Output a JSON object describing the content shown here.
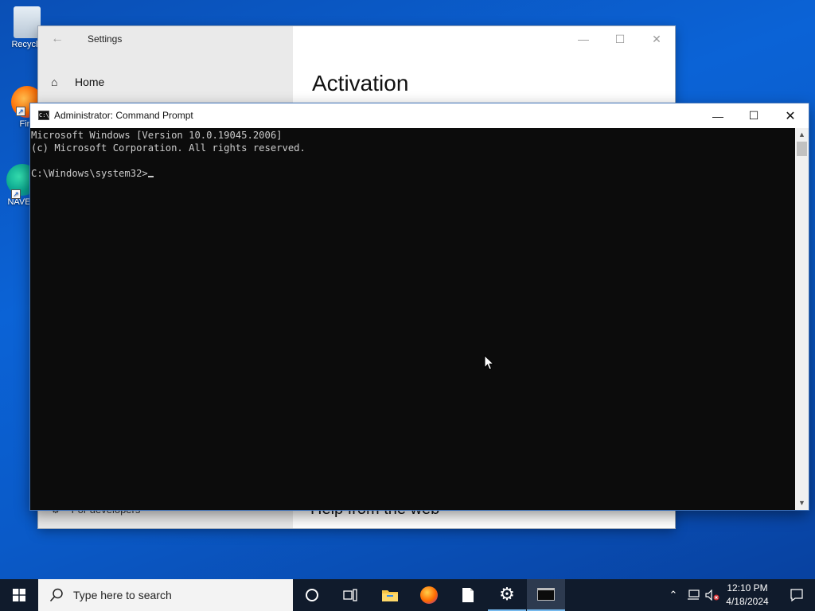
{
  "desktop": {
    "icons": [
      {
        "label": "Recycle"
      },
      {
        "label": "Fire"
      },
      {
        "label": "NAVER"
      }
    ]
  },
  "settings_window": {
    "title": "Settings",
    "nav_home": "Home",
    "page_heading": "Activation",
    "nav_partial": "For developers",
    "section_partial": "Help from the web"
  },
  "cmd_window": {
    "title": "Administrator: Command Prompt",
    "icon_text": "C:\\",
    "lines": [
      "Microsoft Windows [Version 10.0.19045.2006]",
      "(c) Microsoft Corporation. All rights reserved.",
      "",
      "C:\\Windows\\system32>"
    ]
  },
  "taskbar": {
    "search_placeholder": "Type here to search",
    "pinned": [
      "cortana-icon",
      "task-view-icon",
      "file-explorer-icon",
      "firefox-icon",
      "notepad-icon",
      "settings-icon",
      "command-prompt-icon"
    ],
    "time": "12:10 PM",
    "date": "4/18/2024"
  },
  "colors": {
    "accent": "#76b9ed",
    "desktop": "#0b63d6",
    "taskbar": "#101b2c",
    "console_bg": "#0c0c0c",
    "console_fg": "#cccccc"
  }
}
